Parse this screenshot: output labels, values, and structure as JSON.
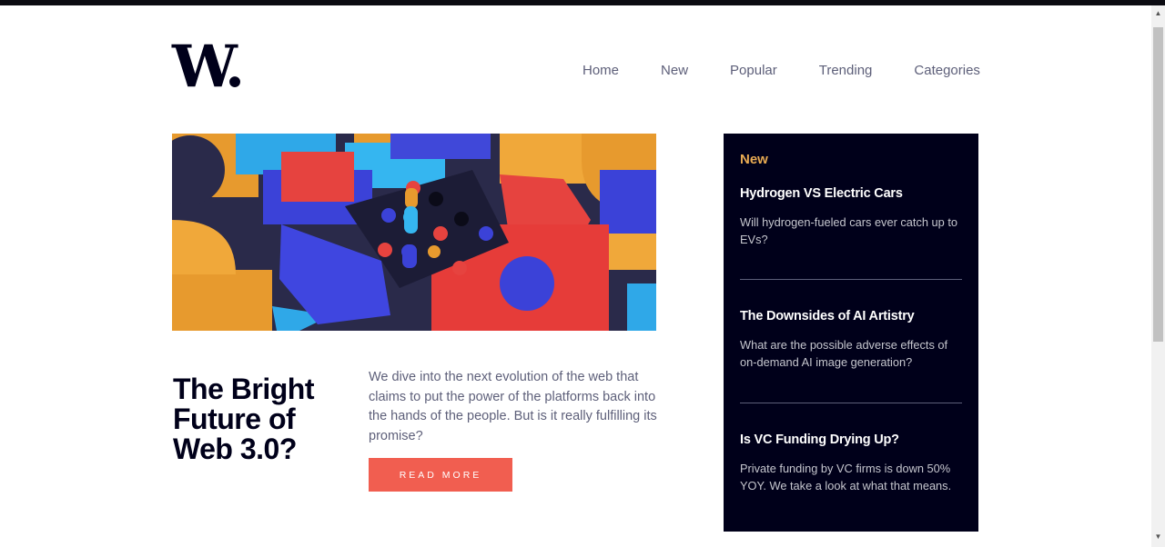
{
  "logo": {
    "text": "W."
  },
  "nav": {
    "items": [
      {
        "label": "Home"
      },
      {
        "label": "New"
      },
      {
        "label": "Popular"
      },
      {
        "label": "Trending"
      },
      {
        "label": "Categories"
      }
    ]
  },
  "hero": {
    "title": "The Bright Future of Web 3.0?",
    "summary": "We dive into the next evolution of the web that claims to put the power of the platforms back into the hands of the people. But is it really fulfilling its promise?",
    "cta_label": "READ MORE"
  },
  "sidebar": {
    "title": "New",
    "articles": [
      {
        "title": "Hydrogen VS Electric Cars",
        "summary": "Will hydrogen-fueled cars ever catch up to EVs?"
      },
      {
        "title": "The Downsides of AI Artistry",
        "summary": "What are the possible adverse effects of on-demand AI image generation?"
      },
      {
        "title": "Is VC Funding Drying Up?",
        "summary": "Private funding by VC firms is down 50% YOY. We take a look at what that means."
      }
    ]
  },
  "colors": {
    "dark": "#00001a",
    "accent_red": "#f15e50",
    "accent_orange": "#e9ab53",
    "grayish_blue": "#5d5f79"
  }
}
